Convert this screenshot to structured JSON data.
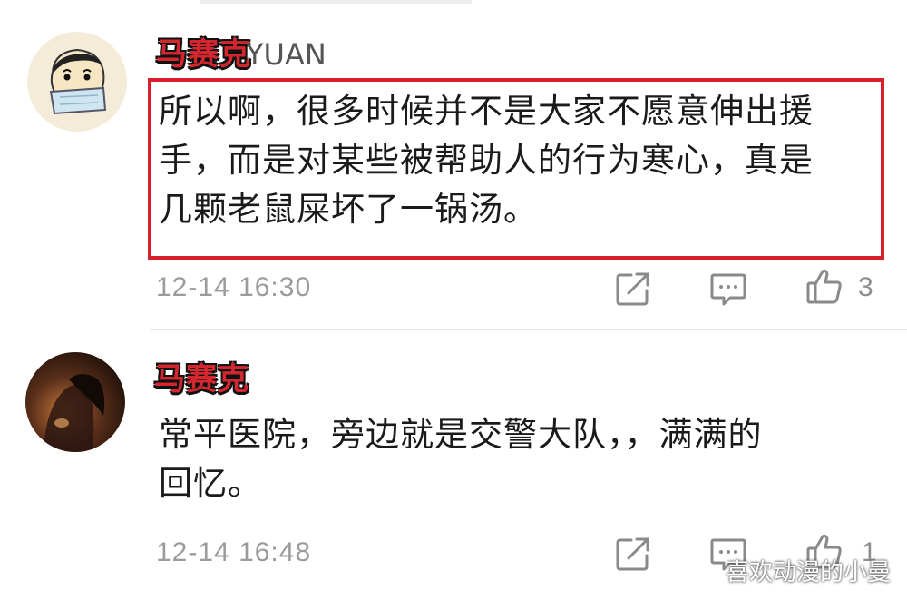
{
  "comments": [
    {
      "username_redacted": "马赛克",
      "username_tail": "YUAN",
      "text_lines": [
        "所以啊，很多时候并不是大家不愿意伸出援",
        "手，而是对某些被帮助人的行为寒心，真是",
        "几颗老鼠屎坏了一锅汤。"
      ],
      "time": "12-14 16:30",
      "likes": "3",
      "avatar": "cartoon-boy-avatar"
    },
    {
      "username_redacted": "马赛克",
      "text_lines": [
        "常平医院，旁边就是交警大队，，满满的",
        "回忆。"
      ],
      "time": "12-14 16:48",
      "likes": "1",
      "avatar": "dark-photo-avatar"
    }
  ],
  "icons": [
    "share-icon",
    "comment-icon",
    "like-icon"
  ],
  "colors": {
    "highlight": "#d7202a",
    "time": "#9b9b9b",
    "redacted": "#d4262e"
  },
  "watermark": {
    "text": "喜欢动漫的小曼",
    "icon": "wechat-icon"
  }
}
